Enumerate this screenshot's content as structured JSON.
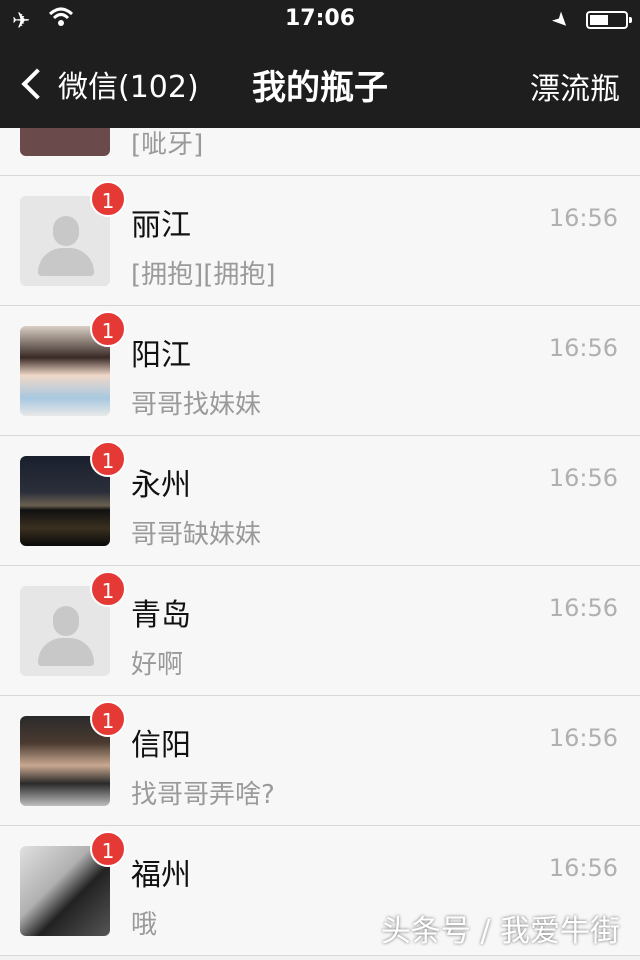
{
  "status_bar": {
    "time": "17:06"
  },
  "nav": {
    "back_label": "微信(102)",
    "title": "我的瓶子",
    "right_label": "漂流瓶"
  },
  "partial_row": {
    "msg": "[呲牙]"
  },
  "conversations": [
    {
      "name": "丽江",
      "msg": "[拥抱][拥抱]",
      "time": "16:56",
      "badge": "1",
      "avatar": "placeholder-avatar"
    },
    {
      "name": "阳江",
      "msg": "哥哥找妹妹",
      "time": "16:56",
      "badge": "1",
      "avatar": "woman-photo-avatar"
    },
    {
      "name": "永州",
      "msg": "哥哥缺妹妹",
      "time": "16:56",
      "badge": "1",
      "avatar": "night-city-avatar"
    },
    {
      "name": "青岛",
      "msg": "好啊",
      "time": "16:56",
      "badge": "1",
      "avatar": "placeholder-avatar"
    },
    {
      "name": "信阳",
      "msg": "找哥哥弄啥?",
      "time": "16:56",
      "badge": "1",
      "avatar": "man-photo-avatar"
    },
    {
      "name": "福州",
      "msg": "哦",
      "time": "16:56",
      "badge": "1",
      "avatar": "man-bw-avatar"
    }
  ],
  "watermark": "头条号 / 我爱牛街",
  "colors": {
    "bar_bg": "#1e1e1e",
    "badge": "#e53935",
    "list_bg": "#f7f7f7"
  }
}
